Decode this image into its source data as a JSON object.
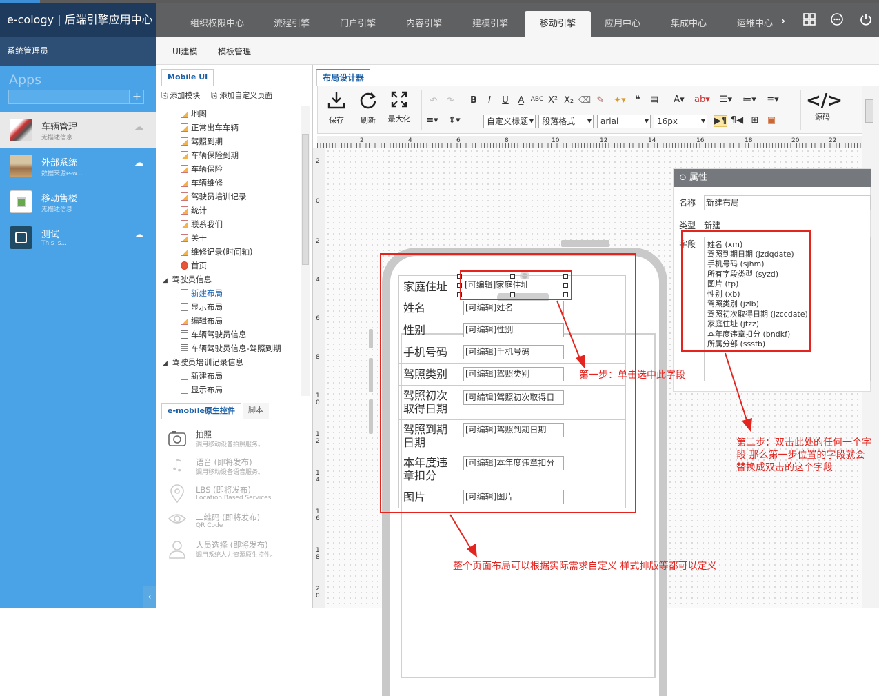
{
  "brand": "e-cology | 后端引擎应用中心",
  "topnav": {
    "tabs": [
      "组织权限中心",
      "流程引擎",
      "门户引擎",
      "内容引擎",
      "建模引擎",
      "移动引擎",
      "应用中心",
      "集成中心",
      "运维中心"
    ],
    "active_tab": "移动引擎",
    "icons": [
      "chevron-right-icon",
      "grid-icon",
      "more-icon",
      "power-icon"
    ]
  },
  "user": "系统管理员",
  "subnav": [
    "UI建模",
    "模板管理"
  ],
  "apps": {
    "title": "Apps",
    "add_symbol": "+",
    "items": [
      {
        "name": "车辆管理",
        "desc": "无描述信息",
        "active": true
      },
      {
        "name": "外部系统",
        "desc": "数据来源e-w..."
      },
      {
        "name": "移动售楼",
        "desc": "无描述信息"
      },
      {
        "name": "测试",
        "desc": "This is..."
      }
    ]
  },
  "left_panel": {
    "tab": "Mobile UI",
    "add_module": "添加模块",
    "add_custom_page": "添加自定义页面",
    "tree": [
      {
        "label": "地图",
        "icon": "edit"
      },
      {
        "label": "正常出车车辆",
        "icon": "edit"
      },
      {
        "label": "驾照到期",
        "icon": "edit"
      },
      {
        "label": "车辆保险到期",
        "icon": "edit"
      },
      {
        "label": "车辆保险",
        "icon": "edit"
      },
      {
        "label": "车辆维修",
        "icon": "edit"
      },
      {
        "label": "驾驶员培训记录",
        "icon": "edit"
      },
      {
        "label": "统计",
        "icon": "edit"
      },
      {
        "label": "联系我们",
        "icon": "edit"
      },
      {
        "label": "关于",
        "icon": "edit"
      },
      {
        "label": "维修记录(时间轴)",
        "icon": "edit"
      },
      {
        "label": "首页",
        "icon": "home"
      },
      {
        "label": "驾驶员信息",
        "icon": "folder"
      },
      {
        "label": "新建布局",
        "icon": "page-add",
        "selected": true
      },
      {
        "label": "显示布局",
        "icon": "page"
      },
      {
        "label": "编辑布局",
        "icon": "edit"
      },
      {
        "label": "车辆驾驶员信息",
        "icon": "form"
      },
      {
        "label": "车辆驾驶员信息-驾照到期",
        "icon": "form"
      },
      {
        "label": "驾驶员培训记录信息",
        "icon": "folder"
      },
      {
        "label": "新建布局",
        "icon": "page-add"
      },
      {
        "label": "显示布局",
        "icon": "page"
      }
    ],
    "bottom_tabs": [
      "e-mobile原生控件",
      "脚本"
    ],
    "controls": [
      {
        "name": "拍照",
        "desc": "调用移动设备拍照服务。",
        "icon": "camera-icon"
      },
      {
        "name": "语音 (即将发布)",
        "desc": "调用移动设备语音服务。",
        "icon": "music-note-icon"
      },
      {
        "name": "LBS (即将发布)",
        "desc": "Location Based Services",
        "icon": "location-pin-icon"
      },
      {
        "name": "二维码 (即将发布)",
        "desc": "QR Code",
        "icon": "eye-icon"
      },
      {
        "name": "人员选择 (即将发布)",
        "desc": "调用系统人力资源原生控件。",
        "icon": "person-icon"
      }
    ]
  },
  "designer": {
    "tab": "布局设计器",
    "toolbar": {
      "save": "保存",
      "refresh": "刷新",
      "maximize": "最大化",
      "source": "源码",
      "style_select": "自定义标题",
      "para_select": "段落格式",
      "font_select": "arial",
      "size_select": "16px"
    },
    "ruler_h": [
      "2",
      "4",
      "6",
      "8",
      "10",
      "12",
      "14",
      "16",
      "18",
      "20",
      "22"
    ],
    "ruler_v": [
      "2",
      "0",
      "2",
      "4",
      "6",
      "8",
      "1\n0",
      "1\n2",
      "1\n4",
      "1\n6",
      "1\n8",
      "2\n0"
    ],
    "form_rows": [
      {
        "label": "家庭住址",
        "value": "[可编辑]家庭住址"
      },
      {
        "label": "姓名",
        "value": "[可编辑]姓名"
      },
      {
        "label": "性别",
        "value": "[可编辑]性别"
      },
      {
        "label": "手机号码",
        "value": "[可编辑]手机号码"
      },
      {
        "label": "驾照类别",
        "value": "[可编辑]驾照类别"
      },
      {
        "label": "驾照初次取得日期",
        "value": "[可编辑]驾照初次取得日"
      },
      {
        "label": "驾照到期日期",
        "value": "[可编辑]驾照到期日期"
      },
      {
        "label": "本年度违章扣分",
        "value": "[可编辑]本年度违章扣分"
      },
      {
        "label": "图片",
        "value": "[可编辑]图片"
      }
    ]
  },
  "properties": {
    "title": "属性",
    "name_label": "名称",
    "name_value": "新建布局",
    "type_label": "类型",
    "type_value": "新建",
    "field_label": "字段",
    "fields": [
      "姓名 (xm)",
      "驾照到期日期 (jzdqdate)",
      "手机号码 (sjhm)",
      "所有字段类型 (syzd)",
      "图片 (tp)",
      "性别 (xb)",
      "驾照类别 (jzlb)",
      "驾照初次取得日期 (jzccdate)",
      "家庭住址 (jtzz)",
      "本年度违章扣分 (bndkf)",
      "所属分部 (sssfb)"
    ]
  },
  "annotations": {
    "step1": "第一步：单击选中此字段",
    "step2": "第二步：双击此处的任何一个字段 那么第一步位置的字段就会替换成双击的这个字段",
    "layout_note": "整个页面布局可以根据实际需求自定义 样式排版等都可以定义"
  },
  "colors": {
    "annotation_red": "#e3241f",
    "sidebar_blue": "#4aa3e6",
    "topnav_gray": "#5f6062",
    "brand_navy": "#1e3a5c"
  }
}
